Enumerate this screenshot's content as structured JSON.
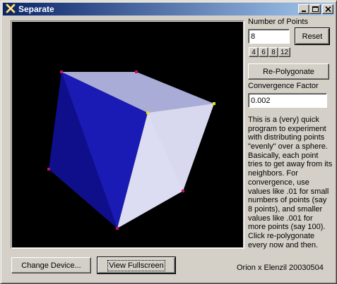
{
  "window": {
    "title": "Separate",
    "icon": "app-x-icon",
    "controls": [
      "minimize-icon",
      "maximize-icon",
      "close-icon"
    ]
  },
  "viewport": {
    "description": "3D view of points on a sphere forming a polyhedron",
    "background": "#000000",
    "face_colors": [
      "#1a1ab4",
      "#0f0f8c",
      "#a8acd6",
      "#dcdcf2",
      "#d8d8ef"
    ],
    "point_colors": [
      "#c0106e",
      "#e0e020"
    ]
  },
  "controls": {
    "num_points_label": "Number of Points",
    "num_points_value": "8",
    "reset_label": "Reset",
    "presets": [
      "4",
      "6",
      "8",
      "12"
    ],
    "repolygonate_label": "Re-Polygonate",
    "convergence_label": "Convergence Factor",
    "convergence_value": "0.002"
  },
  "description_lines": [
    "This is a (very) quick",
    "program to experiment",
    "with distributing points",
    "\"evenly\" over a sphere.",
    "Basically, each point",
    "tries to get away from its",
    "neighbors. For",
    "convergence, use",
    "values like .01 for small",
    "numbers of points (say",
    "8 points), and smaller",
    "values like .001 for",
    "more points (say 100).",
    "Click re-polygonate",
    "every now and then."
  ],
  "bottom": {
    "change_device_label": "Change Device...",
    "view_fullscreen_label": "View Fullscreen",
    "credit": "Orion x Elenzil 20030504"
  }
}
